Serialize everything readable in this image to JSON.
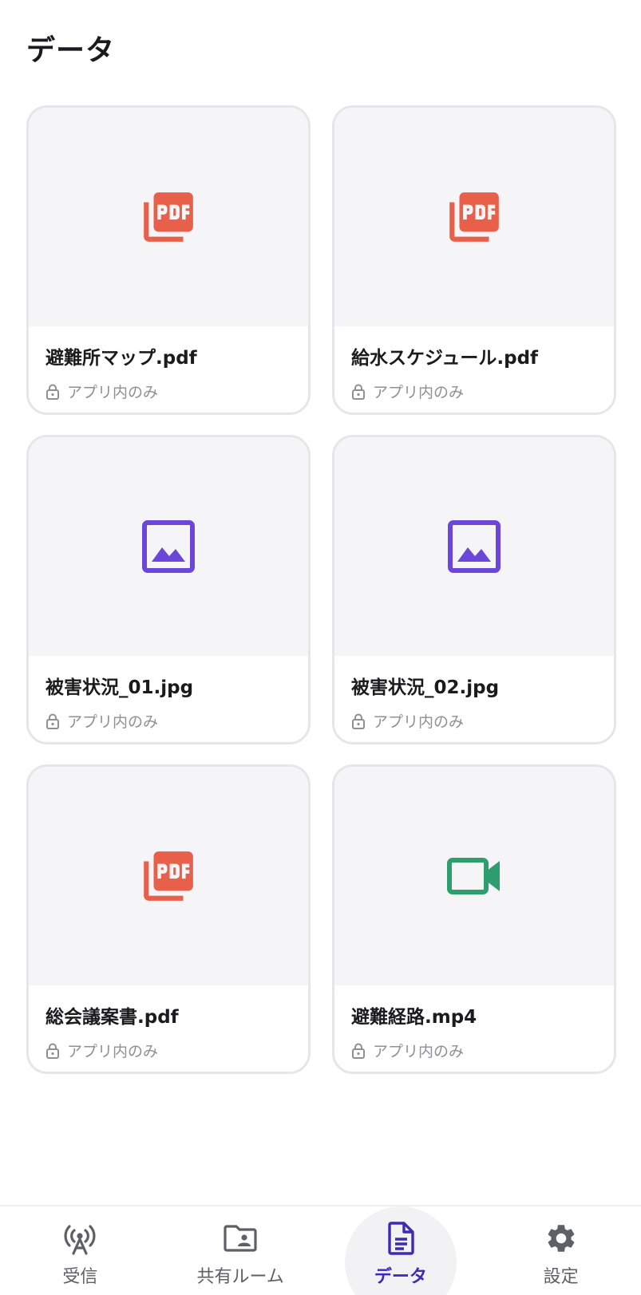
{
  "header": {
    "title": "データ"
  },
  "colors": {
    "pdf": "#e8604a",
    "image": "#6b46d9",
    "video": "#2e9e6e",
    "accent": "#3d2bb5"
  },
  "files": [
    {
      "name": "避難所マップ.pdf",
      "type_icon": "pdf-icon",
      "access": "アプリ内のみ"
    },
    {
      "name": "給水スケジュール.pdf",
      "type_icon": "pdf-icon",
      "access": "アプリ内のみ"
    },
    {
      "name": "被害状況_01.jpg",
      "type_icon": "image-icon",
      "access": "アプリ内のみ"
    },
    {
      "name": "被害状況_02.jpg",
      "type_icon": "image-icon",
      "access": "アプリ内のみ"
    },
    {
      "name": "総会議案書.pdf",
      "type_icon": "pdf-icon",
      "access": "アプリ内のみ"
    },
    {
      "name": "避難経路.mp4",
      "type_icon": "video-icon",
      "access": "アプリ内のみ"
    }
  ],
  "nav": {
    "items": [
      {
        "label": "受信",
        "icon": "antenna-icon",
        "active": false
      },
      {
        "label": "共有ルーム",
        "icon": "shared-folder-icon",
        "active": false
      },
      {
        "label": "データ",
        "icon": "document-icon",
        "active": true
      },
      {
        "label": "設定",
        "icon": "gear-icon",
        "active": false
      }
    ]
  }
}
